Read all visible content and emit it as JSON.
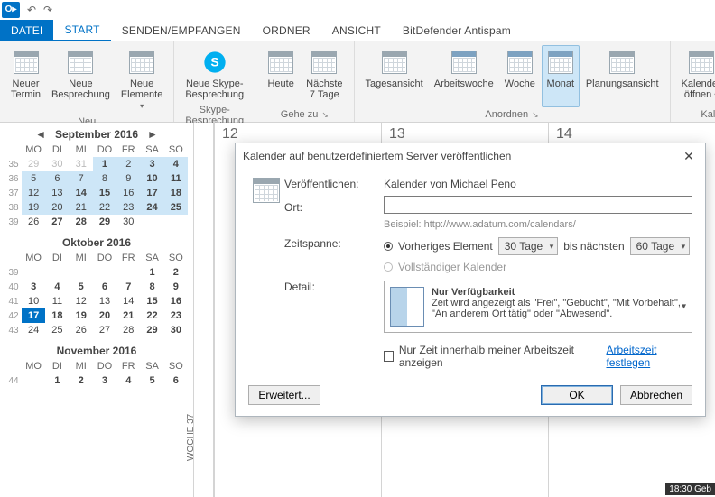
{
  "app": {
    "badge": "O▸"
  },
  "tabs": {
    "file": "DATEI",
    "start": "START",
    "senden": "SENDEN/EMPFANGEN",
    "ordner": "ORDNER",
    "ansicht": "ANSICHT",
    "bitdefender": "BitDefender Antispam"
  },
  "ribbon": {
    "neu_group": "Neu",
    "neuer_termin": "Neuer\nTermin",
    "neue_besprechung": "Neue\nBesprechung",
    "neue_elemente": "Neue\nElemente ",
    "skype_group": "Skype-Besprechung",
    "neue_skype": "Neue Skype-\nBesprechung",
    "gehe_group": "Gehe zu",
    "heute": "Heute",
    "naechste": "Nächste\n7 Tage",
    "anordnen_group": "Anordnen",
    "tagesansicht": "Tagesansicht",
    "arbeitswoche": "Arbeitswoche",
    "woche": "Woche",
    "monat": "Monat",
    "planungsansicht": "Planungsansicht",
    "kalende_group": "Kalende",
    "kalender_oeffnen": "Kalender\nöffnen ",
    "ka": "Ka"
  },
  "minis": {
    "dow": [
      "MO",
      "DI",
      "MI",
      "DO",
      "FR",
      "SA",
      "SO"
    ],
    "sep": {
      "title": "September 2016",
      "rows": [
        {
          "wk": "35",
          "d": [
            [
              "29",
              "dim"
            ],
            [
              "30",
              "dim"
            ],
            [
              "31",
              "dim"
            ],
            [
              "1",
              "hl bold"
            ],
            [
              "2",
              "hl"
            ],
            [
              "3",
              "hl bold"
            ],
            [
              "4",
              "hl bold"
            ]
          ]
        },
        {
          "wk": "36",
          "d": [
            [
              "5",
              "hl"
            ],
            [
              "6",
              "hl"
            ],
            [
              "7",
              "hl"
            ],
            [
              "8",
              "hl"
            ],
            [
              "9",
              "hl"
            ],
            [
              "10",
              "hl bold"
            ],
            [
              "11",
              "hl bold"
            ]
          ]
        },
        {
          "wk": "37",
          "d": [
            [
              "12",
              "hl"
            ],
            [
              "13",
              "hl"
            ],
            [
              "14",
              "hl bold"
            ],
            [
              "15",
              "hl bold"
            ],
            [
              "16",
              "hl"
            ],
            [
              "17",
              "hl bold"
            ],
            [
              "18",
              "hl bold"
            ]
          ]
        },
        {
          "wk": "38",
          "d": [
            [
              "19",
              "hl"
            ],
            [
              "20",
              "hl"
            ],
            [
              "21",
              "hl"
            ],
            [
              "22",
              "hl"
            ],
            [
              "23",
              "hl"
            ],
            [
              "24",
              "hl bold"
            ],
            [
              "25",
              "hl bold"
            ]
          ]
        },
        {
          "wk": "39",
          "d": [
            [
              "26",
              ""
            ],
            [
              "27",
              "bold"
            ],
            [
              "28",
              "bold"
            ],
            [
              "29",
              "bold"
            ],
            [
              "30",
              ""
            ],
            [
              "",
              ""
            ],
            [
              "",
              ""
            ]
          ]
        }
      ]
    },
    "oct": {
      "title": "Oktober 2016",
      "rows": [
        {
          "wk": "39",
          "d": [
            [
              "",
              ""
            ],
            [
              "",
              ""
            ],
            [
              "",
              ""
            ],
            [
              "",
              ""
            ],
            [
              "",
              ""
            ],
            [
              "1",
              "bold"
            ],
            [
              "2",
              "bold"
            ]
          ]
        },
        {
          "wk": "40",
          "d": [
            [
              "3",
              "bold"
            ],
            [
              "4",
              "bold"
            ],
            [
              "5",
              "bold"
            ],
            [
              "6",
              "bold"
            ],
            [
              "7",
              "bold"
            ],
            [
              "8",
              "bold"
            ],
            [
              "9",
              "bold"
            ]
          ]
        },
        {
          "wk": "41",
          "d": [
            [
              "10",
              ""
            ],
            [
              "11",
              ""
            ],
            [
              "12",
              ""
            ],
            [
              "13",
              ""
            ],
            [
              "14",
              ""
            ],
            [
              "15",
              "bold"
            ],
            [
              "16",
              "bold"
            ]
          ]
        },
        {
          "wk": "42",
          "d": [
            [
              "17",
              "today"
            ],
            [
              "18",
              "bold"
            ],
            [
              "19",
              "bold"
            ],
            [
              "20",
              "bold"
            ],
            [
              "21",
              "bold"
            ],
            [
              "22",
              "bold"
            ],
            [
              "23",
              "bold"
            ]
          ]
        },
        {
          "wk": "43",
          "d": [
            [
              "24",
              ""
            ],
            [
              "25",
              ""
            ],
            [
              "26",
              ""
            ],
            [
              "27",
              ""
            ],
            [
              "28",
              ""
            ],
            [
              "29",
              "bold"
            ],
            [
              "30",
              "bold"
            ]
          ]
        }
      ]
    },
    "nov": {
      "title": "November 2016",
      "rows": [
        {
          "wk": "44",
          "d": [
            [
              "",
              ""
            ],
            [
              "1",
              "bold"
            ],
            [
              "2",
              "bold"
            ],
            [
              "3",
              "bold"
            ],
            [
              "4",
              "bold"
            ],
            [
              "5",
              "bold"
            ],
            [
              "6",
              "bold"
            ]
          ]
        }
      ]
    }
  },
  "content": {
    "week_label": "WOCHE 37",
    "days": [
      "12",
      "13",
      "14"
    ],
    "appt": "18:30 Geb"
  },
  "dialog": {
    "title": "Kalender auf benutzerdefiniertem Server veröffentlichen",
    "veroff_label": "Veröffentlichen:",
    "veroff_value": "Kalender von Michael Peno",
    "ort_label": "Ort:",
    "ort_value": "",
    "ort_hint": "Beispiel: http://www.adatum.com/calendars/",
    "zeit_label": "Zeitspanne:",
    "radio_prev": "Vorheriges Element",
    "combo_prev": "30 Tage",
    "bis": "bis nächsten",
    "combo_next": "60 Tage",
    "radio_full": "Vollständiger Kalender",
    "detail_label": "Detail:",
    "detail_head": "Nur Verfügbarkeit",
    "detail_text": "Zeit wird angezeigt als \"Frei\", \"Gebucht\", \"Mit Vorbehalt\", \"An anderem Ort tätig\" oder \"Abwesend\".",
    "chk_label": "Nur Zeit innerhalb meiner Arbeitszeit anzeigen",
    "link": "Arbeitszeit festlegen",
    "erweitert": "Erweitert...",
    "ok": "OK",
    "abbrechen": "Abbrechen"
  }
}
